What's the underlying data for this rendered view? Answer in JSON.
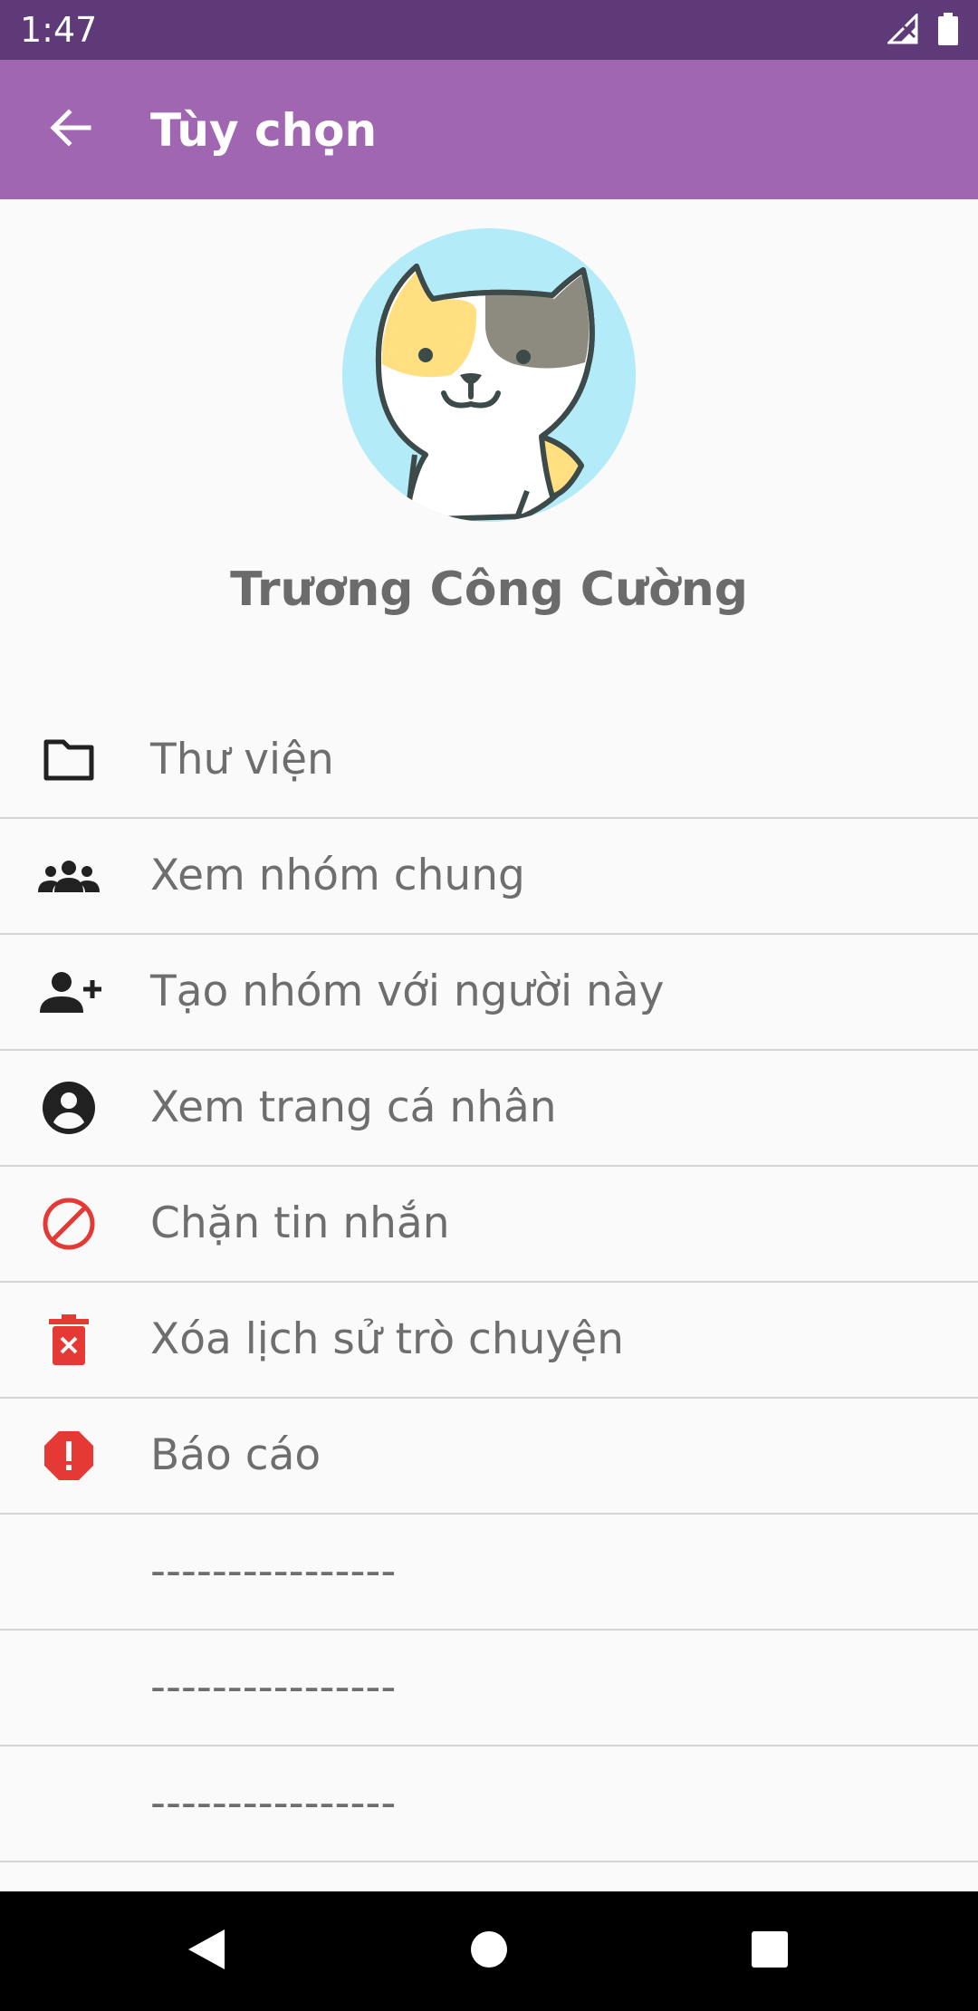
{
  "status_bar": {
    "time": "1:47",
    "icons": [
      "signal-icon",
      "battery-icon"
    ]
  },
  "app_bar": {
    "title": "Tùy chọn",
    "back_icon": "arrow-back-icon",
    "background": "#a066b1",
    "status_background": "#5e3a78"
  },
  "profile": {
    "name": "Trương Công Cường",
    "avatar": "cat-avatar"
  },
  "menu": {
    "items": [
      {
        "label": "Thư viện",
        "icon": "folder-icon",
        "icon_color": "#212121"
      },
      {
        "label": "Xem nhóm chung",
        "icon": "group-icon",
        "icon_color": "#212121"
      },
      {
        "label": "Tạo nhóm với người này",
        "icon": "add-person-icon",
        "icon_color": "#212121"
      },
      {
        "label": "Xem trang cá nhân",
        "icon": "account-circle-icon",
        "icon_color": "#212121"
      },
      {
        "label": "Chặn tin nhắn",
        "icon": "block-icon",
        "icon_color": "#e53935"
      },
      {
        "label": "Xóa lịch sử trò chuyện",
        "icon": "delete-icon",
        "icon_color": "#e53935"
      },
      {
        "label": "Báo cáo",
        "icon": "report-icon",
        "icon_color": "#e53935"
      },
      {
        "label": "----------------",
        "icon": "",
        "icon_color": ""
      },
      {
        "label": "----------------",
        "icon": "",
        "icon_color": ""
      },
      {
        "label": "----------------",
        "icon": "",
        "icon_color": ""
      }
    ]
  },
  "nav_bar": {
    "buttons": [
      "back-triangle-icon",
      "home-circle-icon",
      "recents-square-icon"
    ]
  }
}
